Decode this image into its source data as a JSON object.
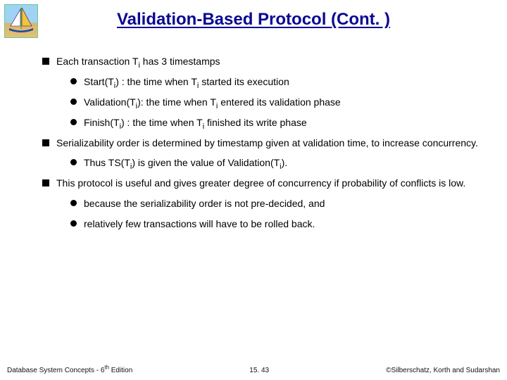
{
  "title": "Validation-Based Protocol (Cont. )",
  "bullets": {
    "b1": {
      "pre": "Each transaction T",
      "sub": "i",
      "post": " has 3 timestamps"
    },
    "b1a": {
      "pre": "Start(T",
      "sub1": "i",
      "mid": ") : the time when T",
      "sub2": "i",
      "post": " started its execution"
    },
    "b1b": {
      "pre": "Validation(T",
      "sub1": "i",
      "mid": "): the time when T",
      "sub2": "i",
      "post": " entered its validation phase"
    },
    "b1c": {
      "pre": "Finish(T",
      "sub1": "i",
      "mid": ") : the time when T",
      "sub2": "i",
      "post": " finished its write phase"
    },
    "b2": "Serializability order is determined by timestamp given at validation time,  to increase concurrency.",
    "b2a": {
      "pre": "Thus TS(T",
      "sub1": "i",
      "mid": ") is given the value of Validation(T",
      "sub2": "i",
      "post": ")."
    },
    "b3": "This protocol is useful and gives greater degree of concurrency if probability of conflicts is low.",
    "b3a": "because the serializability order is not pre-decided, and",
    "b3b": "relatively few transactions will have to be rolled back."
  },
  "footer": {
    "left_pre": "Database System Concepts - 6",
    "left_sup": "th",
    "left_post": " Edition",
    "center": "15. 43",
    "right": "©Silberschatz, Korth and Sudarshan"
  }
}
